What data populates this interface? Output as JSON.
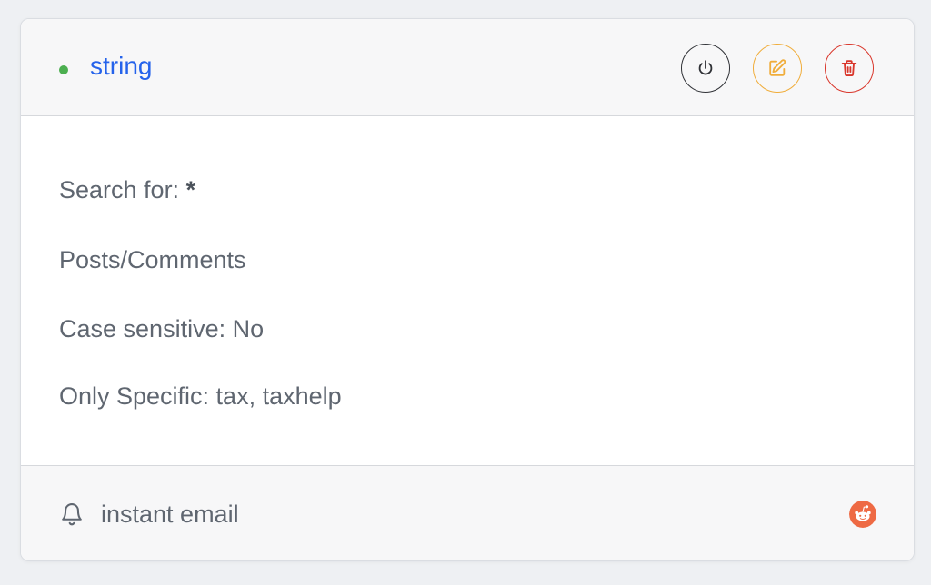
{
  "alert": {
    "title": "string",
    "status": "active",
    "status_color": "#4caf50",
    "title_color": "#2563eb"
  },
  "actions": [
    {
      "name": "power-button",
      "icon": "power-icon",
      "color": "#2f3136"
    },
    {
      "name": "edit-button",
      "icon": "edit-icon",
      "color": "#f0ad3b"
    },
    {
      "name": "delete-button",
      "icon": "trash-icon",
      "color": "#d9362b"
    }
  ],
  "details": {
    "search_for_label": "Search for:",
    "search_for_value": "*",
    "content_type": "Posts/Comments",
    "case_sensitive": "Case sensitive: No",
    "only_specific": "Only Specific: tax, taxhelp"
  },
  "footer": {
    "notification_icon": "bell-icon",
    "notification": "instant email",
    "source_icon": "reddit-icon",
    "source_color": "#ee6a44"
  }
}
